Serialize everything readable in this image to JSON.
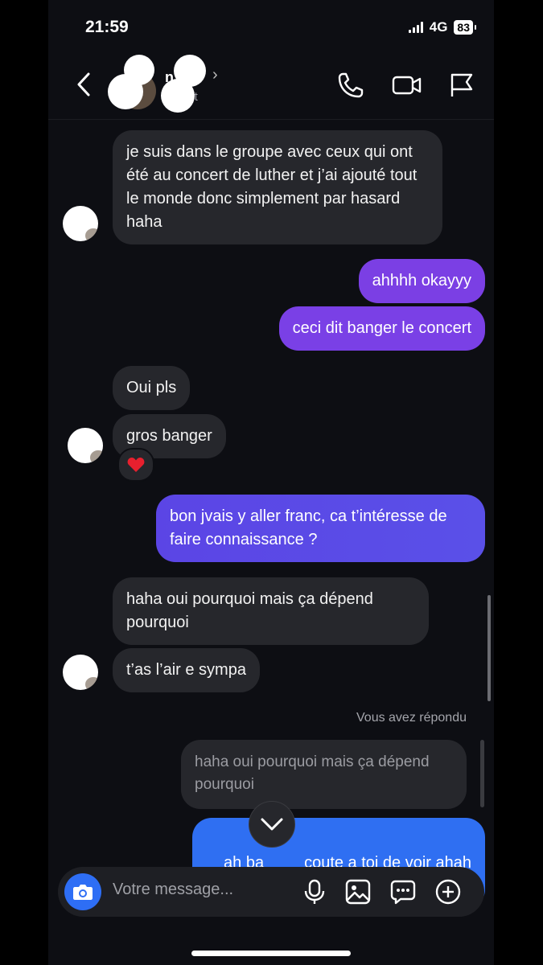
{
  "status_bar": {
    "time": "21:59",
    "network": "4G",
    "battery": "83"
  },
  "header": {
    "name_visible": "n",
    "subtitle_visible": "adt",
    "chevron": "›",
    "icons": [
      "back-chevron-icon",
      "phone-icon",
      "video-camera-icon",
      "flag-icon"
    ]
  },
  "messages": [
    {
      "id": "m1",
      "sender": "them",
      "text": "je suis dans le groupe avec ceux qui ont été au concert de luther et j’ai ajouté tout le monde donc simplement par hasard haha"
    },
    {
      "id": "m2",
      "sender": "me",
      "text": "ahhhh okayyy",
      "color": "#7b3fe4"
    },
    {
      "id": "m3",
      "sender": "me",
      "text": "ceci dit banger le concert",
      "color": "#7a40e6"
    },
    {
      "id": "m4",
      "sender": "them",
      "text": "Oui pls"
    },
    {
      "id": "m5",
      "sender": "them",
      "text": "gros banger",
      "reaction": "❤️"
    },
    {
      "id": "m6",
      "sender": "me",
      "text": "bon jvais y aller franc, ca t’intéresse de faire connaissance ?",
      "color": "#5a4ae6"
    },
    {
      "id": "m7",
      "sender": "them",
      "text": "haha oui pourquoi mais ça dépend pourquoi"
    },
    {
      "id": "m8",
      "sender": "them",
      "text": "t’as l’air e sympa"
    }
  ],
  "reply": {
    "label": "Vous avez répondu",
    "quoted_text": "haha oui pourquoi mais ça dépend pourquoi",
    "message_visible_left": "ah ba",
    "message_visible_right": "coute a toi de voir ahah",
    "color": "#2f6ff2"
  },
  "composer": {
    "placeholder": "Votre message...",
    "icons": [
      "camera-icon",
      "microphone-icon",
      "image-icon",
      "sticker-icon",
      "plus-icon"
    ],
    "camera_color": "#2e6ef5"
  },
  "colors": {
    "background": "#0d0e13",
    "incoming_bubble": "#26272c"
  }
}
